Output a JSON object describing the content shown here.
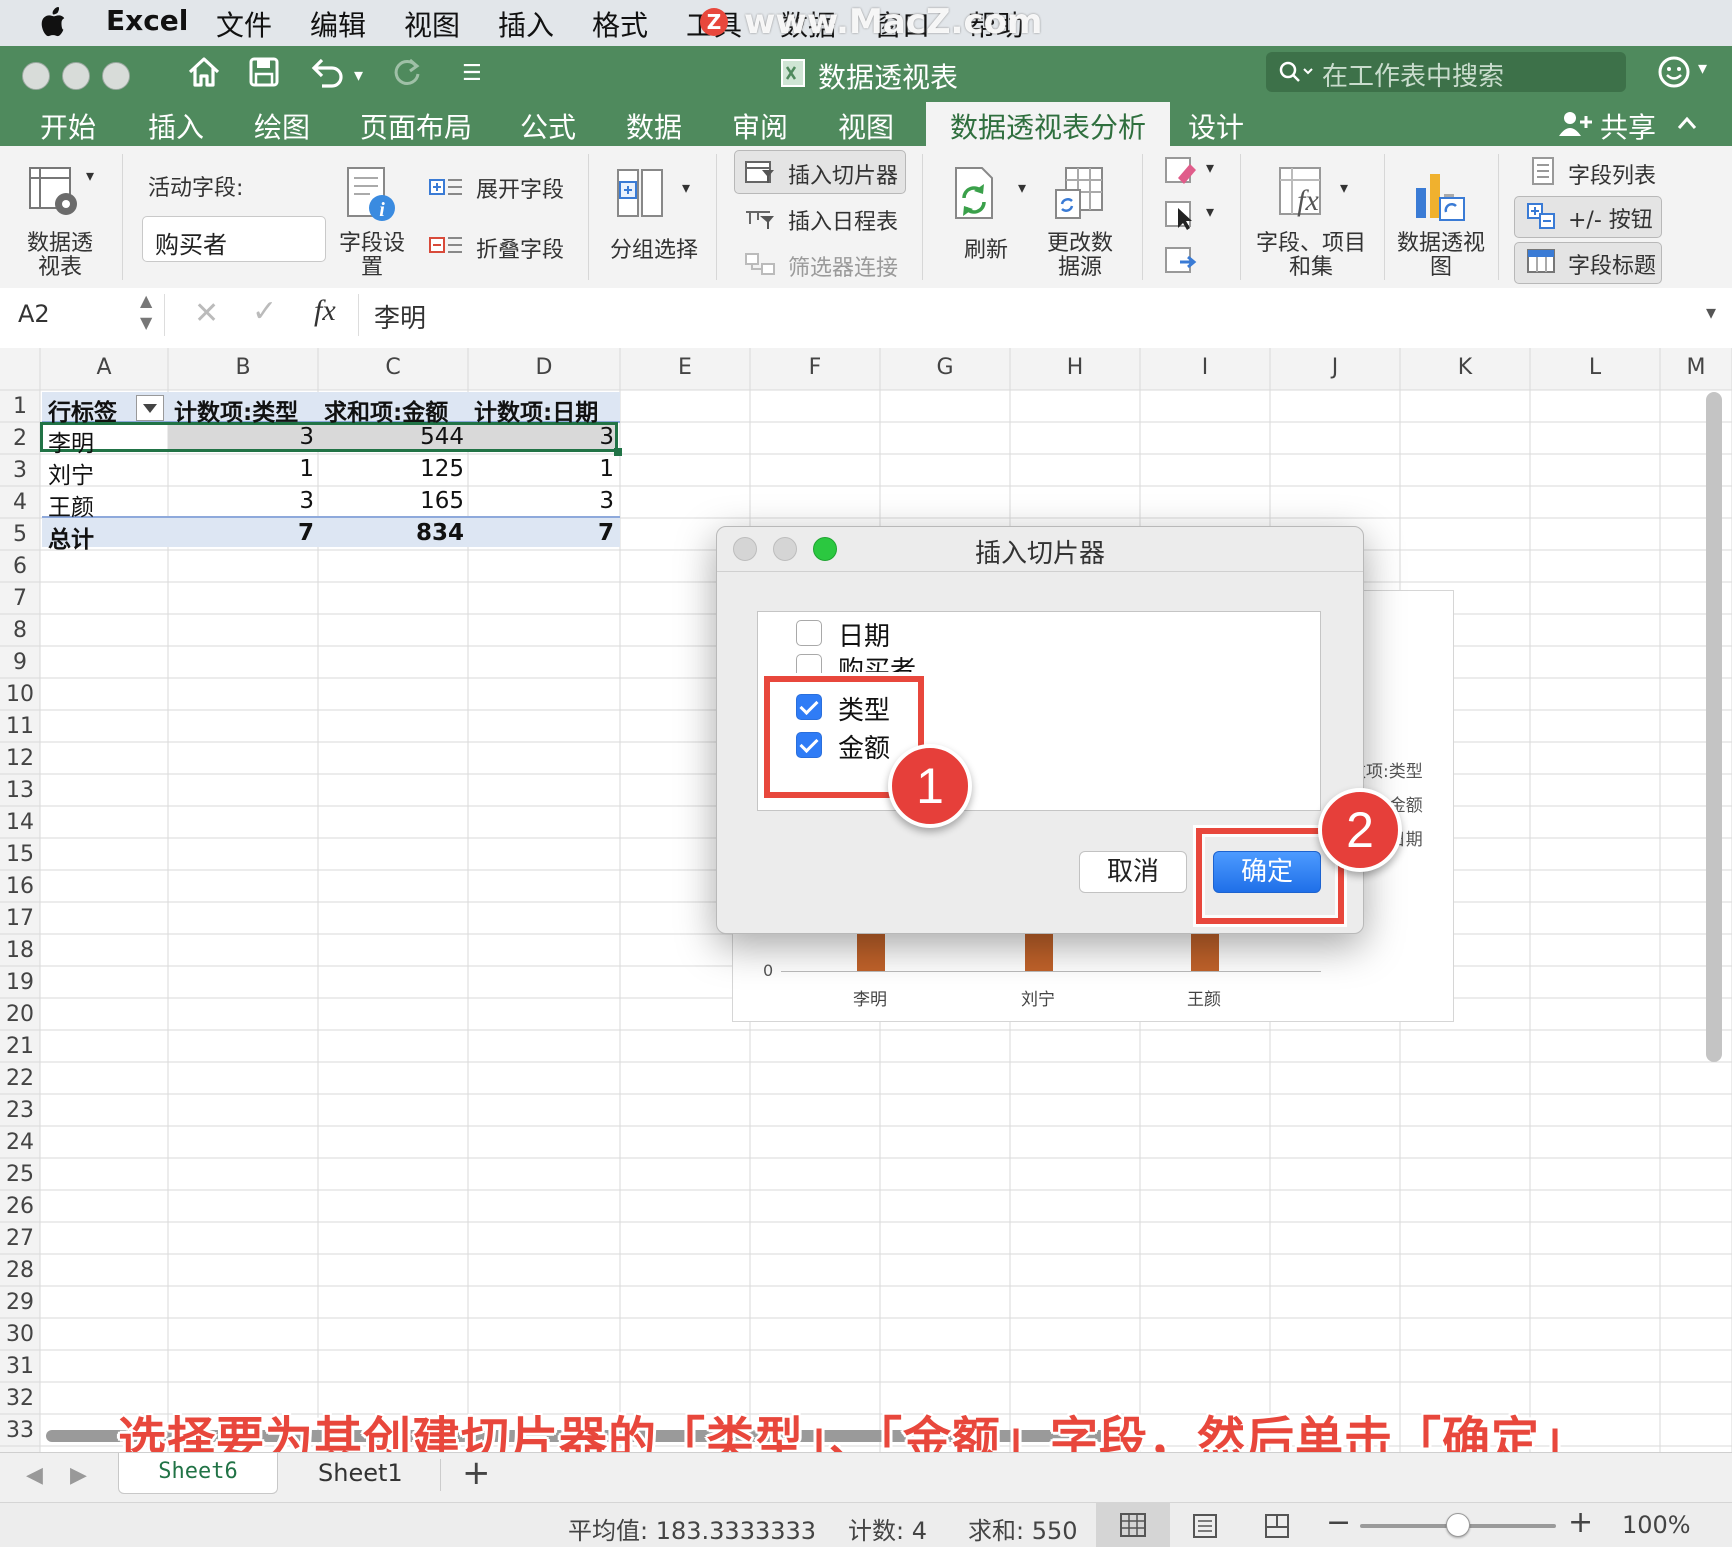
{
  "menubar": {
    "app": "Excel",
    "items": [
      "文件",
      "编辑",
      "视图",
      "插入",
      "格式",
      "工具",
      "数据",
      "窗口",
      "帮助"
    ],
    "watermark": "www.MacZ.com"
  },
  "titlebar": {
    "document_title": "数据透视表",
    "search_placeholder": "在工作表中搜索"
  },
  "tabs": [
    "开始",
    "插入",
    "绘图",
    "页面布局",
    "公式",
    "数据",
    "审阅",
    "视图",
    "数据透视表分析",
    "设计"
  ],
  "active_tab": "数据透视表分析",
  "share_label": "共享",
  "ribbon": {
    "pivot_table": "数据透视表",
    "active_field_label": "活动字段:",
    "active_field_value": "购买者",
    "field_settings": "字段设置",
    "expand_field": "展开字段",
    "collapse_field": "折叠字段",
    "group_selection": "分组选择",
    "insert_slicer": "插入切片器",
    "insert_timeline": "插入日程表",
    "filter_connections": "筛选器连接",
    "refresh": "刷新",
    "change_source": "更改数据源",
    "fields_items_sets": "字段、项目和集",
    "pivot_chart": "数据透视图",
    "field_list": "字段列表",
    "plus_minus_buttons": "+/- 按钮",
    "field_headers": "字段标题"
  },
  "formula_bar": {
    "name_box": "A2",
    "fx": "fx",
    "content": "李明"
  },
  "columns": [
    "A",
    "B",
    "C",
    "D",
    "E",
    "F",
    "G",
    "H",
    "I",
    "J",
    "K",
    "L",
    "M"
  ],
  "rows": [
    "1",
    "2",
    "3",
    "4",
    "5",
    "6",
    "7",
    "8",
    "9",
    "10",
    "11",
    "12",
    "13",
    "14",
    "15",
    "16",
    "17",
    "18",
    "19",
    "20",
    "21",
    "22",
    "23",
    "24",
    "25",
    "26",
    "27",
    "28",
    "29",
    "30",
    "31",
    "32",
    "33"
  ],
  "pivot": {
    "headers": [
      "行标签",
      "计数项:类型",
      "求和项:金额",
      "计数项:日期"
    ],
    "rows": [
      [
        "李明",
        "3",
        "544",
        "3"
      ],
      [
        "刘宁",
        "1",
        "125",
        "1"
      ],
      [
        "王颜",
        "3",
        "165",
        "3"
      ]
    ],
    "total": [
      "总计",
      "7",
      "834",
      "7"
    ]
  },
  "chart_behind": {
    "legend_fragments": [
      "数项:类型",
      "和项:金额",
      "数项:日期"
    ],
    "axis_zero": "0",
    "categories": [
      "李明",
      "刘宁",
      "王颜"
    ]
  },
  "dialog": {
    "title": "插入切片器",
    "options": [
      {
        "label": "日期",
        "checked": false
      },
      {
        "label": "购买者",
        "checked": false
      },
      {
        "label": "类型",
        "checked": true
      },
      {
        "label": "金额",
        "checked": true
      }
    ],
    "cancel": "取消",
    "ok": "确定"
  },
  "callouts": [
    "1",
    "2"
  ],
  "caption": "选择要为其创建切片器的「类型」、「金额」字段，然后单击「确定」",
  "sheet_tabs": [
    "Sheet6",
    "Sheet1"
  ],
  "add_sheet": "+",
  "status": {
    "average": "平均值: 183.3333333",
    "count": "计数: 4",
    "sum": "求和: 550",
    "zoom": "100%"
  },
  "colors": {
    "ribbon_green": "#4f8a5d",
    "accent_blue": "#2f7cf6",
    "callout_red": "#e8473c",
    "bar_orange": "#c0622a"
  }
}
